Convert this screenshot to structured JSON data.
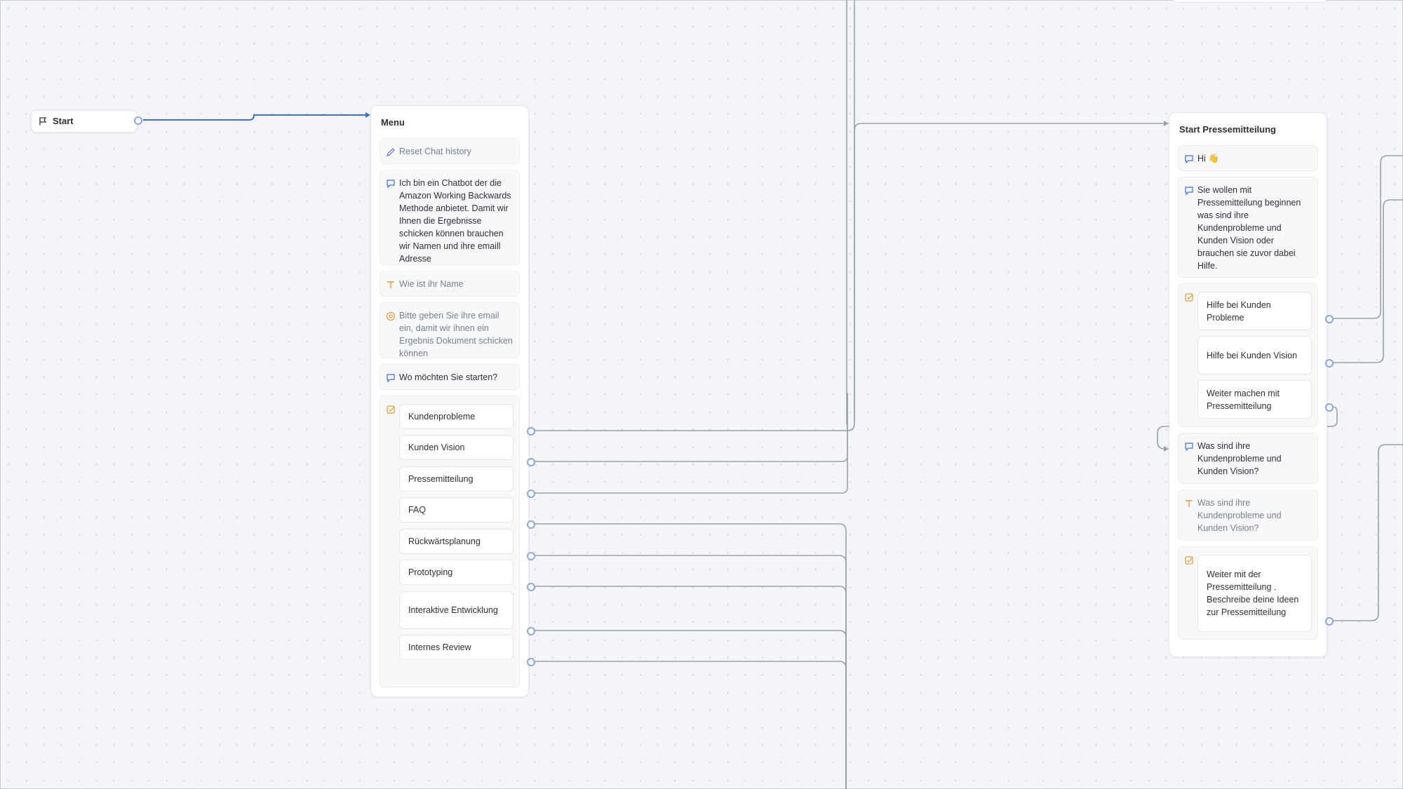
{
  "start": {
    "label": "Start"
  },
  "menu": {
    "title": "Menu",
    "blocks": [
      {
        "type": "set-variable",
        "icon": "pencil-icon",
        "text": "Reset Chat history"
      },
      {
        "type": "text",
        "icon": "chat-bubble-icon",
        "text": "Ich bin ein Chatbot der die Amazon Working Backwards Methode anbietet. Damit wir Ihnen die Ergebnisse schicken können brauchen wir Namen und ihre emaill Adresse"
      },
      {
        "type": "text-input",
        "icon": "text-input-icon",
        "text": "Wie ist ihr Name"
      },
      {
        "type": "email-input",
        "icon": "at-sign-icon",
        "text": "Bitte geben Sie ihre email ein, damit wir ihnen ein Ergebnis Dokument schicken können"
      },
      {
        "type": "text",
        "icon": "chat-bubble-icon",
        "text": "Wo möchten Sie starten?"
      }
    ],
    "choice_icon": "checkbox-icon",
    "choices": [
      "Kundenprobleme",
      "Kunden Vision",
      "Pressemitteilung",
      "FAQ",
      "Rückwärtsplanung",
      "Prototyping",
      "Interaktive Entwicklung",
      "Internes Review"
    ]
  },
  "press": {
    "title": "Start Pressemitteilung",
    "greeting": "Hi 👋",
    "intro": "Sie wollen mit Pressemitteilung beginnen was sind ihre Kundenprobleme und Kunden Vision oder brauchen sie zuvor dabei Hilfe.",
    "choices1": [
      "Hilfe bei Kunden Probleme",
      "Hilfe bei Kunden Vision",
      "Weiter machen mit Pressemitteilung"
    ],
    "question": "Was sind ihre Kundenprobleme und Kunden Vision?",
    "input_placeholder": "Was sind ihre Kundenprobleme und Kunden Vision?",
    "choices2": [
      "Weiter mit der Pressemitteilung . Beschreibe deine Ideen zur Pressemitteilung"
    ]
  },
  "colors": {
    "accent": "#3b6fd8",
    "edge": "#9aa0aa",
    "handle": "#8aa6dd",
    "icon_blue": "#3b6fd8",
    "icon_orange": "#e29a3b"
  }
}
